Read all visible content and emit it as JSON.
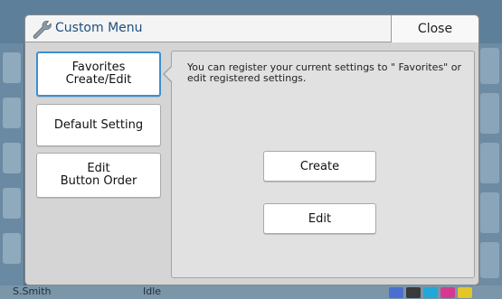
{
  "dialog": {
    "title": "Custom Menu",
    "close_label": "Close",
    "icon": "wrench-icon"
  },
  "menu": {
    "items": [
      {
        "label": "Favorites\nCreate/Edit",
        "selected": true
      },
      {
        "label": "Default Setting",
        "selected": false
      },
      {
        "label": "Edit\nButton Order",
        "selected": false
      }
    ]
  },
  "panel": {
    "description": "You can register your current settings to \" Favorites\" or edit registered settings.",
    "create_label": "Create",
    "edit_label": "Edit"
  },
  "background": {
    "status_user": "S.Smith",
    "status_state": "Idle",
    "ink_colors": [
      "#4a6fd1",
      "#3a3a3a",
      "#22a8d8",
      "#d43b8f",
      "#e2c62a"
    ]
  },
  "colors": {
    "accent": "#3d8fd0",
    "title": "#1f4f7e"
  }
}
